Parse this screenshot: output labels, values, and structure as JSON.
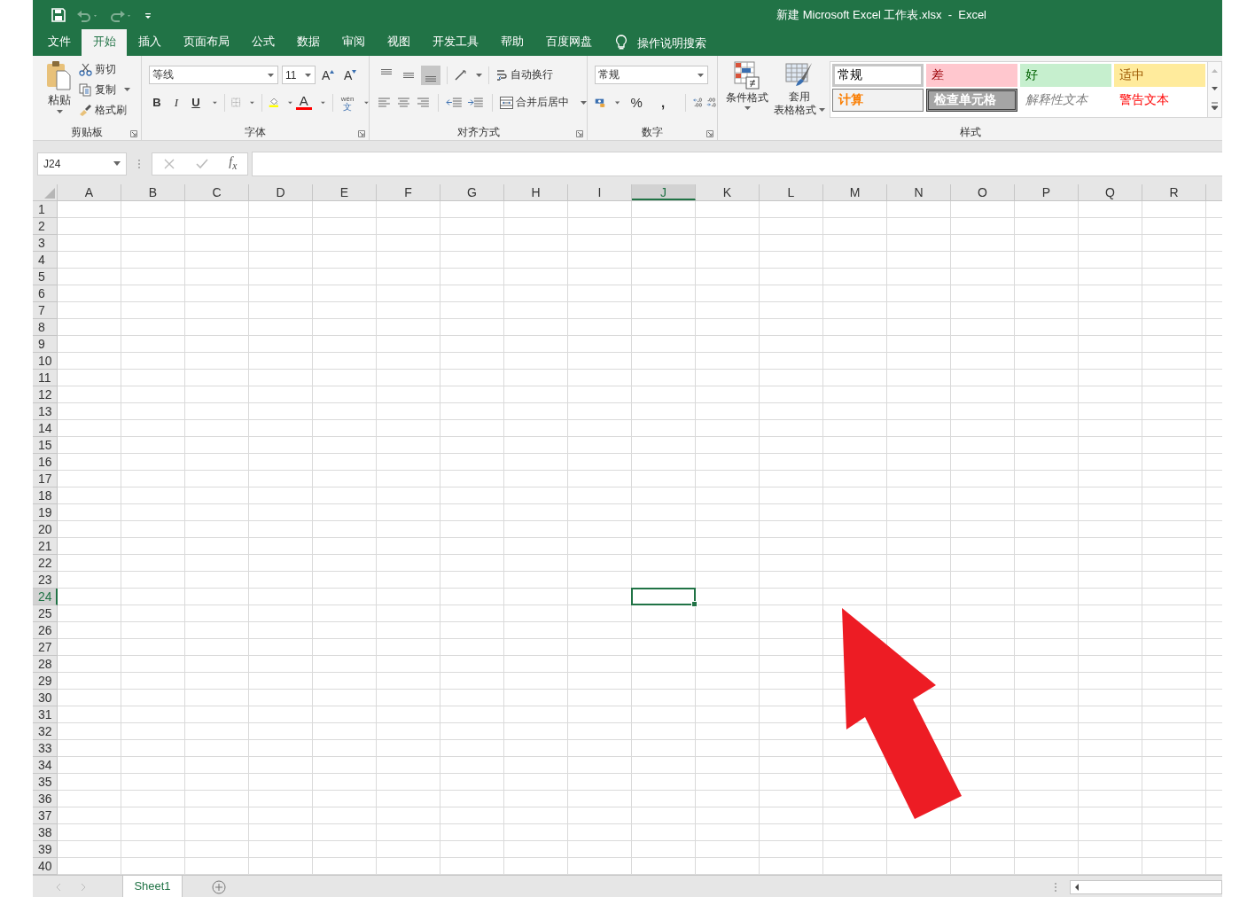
{
  "title_bar": {
    "title": "新建 Microsoft Excel 工作表.xlsx  -  Excel"
  },
  "ribbon_tabs": [
    {
      "label": "文件",
      "selected": false
    },
    {
      "label": "开始",
      "selected": true
    },
    {
      "label": "插入",
      "selected": false
    },
    {
      "label": "页面布局",
      "selected": false
    },
    {
      "label": "公式",
      "selected": false
    },
    {
      "label": "数据",
      "selected": false
    },
    {
      "label": "审阅",
      "selected": false
    },
    {
      "label": "视图",
      "selected": false
    },
    {
      "label": "开发工具",
      "selected": false
    },
    {
      "label": "帮助",
      "selected": false
    },
    {
      "label": "百度网盘",
      "selected": false
    }
  ],
  "tell_me": {
    "label": "操作说明搜索"
  },
  "clipboard": {
    "paste": "粘贴",
    "cut": "剪切",
    "copy": "复制",
    "format_painter": "格式刷",
    "label": "剪贴板"
  },
  "font": {
    "font_name": "等线",
    "font_size": "11",
    "grow": "A",
    "shrink": "A",
    "bold": "B",
    "italic": "I",
    "underline": "U",
    "font_color": "A",
    "phonetic_top": "wén",
    "phonetic_bottom": "文",
    "label": "字体"
  },
  "alignment": {
    "vertical": [
      {
        "kind": "top",
        "selected": false
      },
      {
        "kind": "middle",
        "selected": false
      },
      {
        "kind": "bottom",
        "selected": true
      }
    ],
    "wrap_text": "自动换行",
    "merge_center": "合并后居中",
    "label": "对齐方式"
  },
  "number": {
    "format": "常规",
    "percent": "%",
    "comma": ",",
    "label": "数字"
  },
  "styles": {
    "conditional_formatting": "条件格式",
    "format_as_table": [
      "套用",
      "表格格式"
    ],
    "gallery": [
      {
        "label": "常规",
        "kind": "normal",
        "selected": true
      },
      {
        "label": "差",
        "kind": "bad",
        "selected": false
      },
      {
        "label": "好",
        "kind": "good",
        "selected": false
      },
      {
        "label": "适中",
        "kind": "neutral",
        "selected": false
      },
      {
        "label": "计算",
        "kind": "calculation",
        "selected": false
      },
      {
        "label": "检查单元格",
        "kind": "check",
        "selected": false
      },
      {
        "label": "解释性文本",
        "kind": "explanatory",
        "selected": false
      },
      {
        "label": "警告文本",
        "kind": "warning",
        "selected": false
      }
    ],
    "label": "样式"
  },
  "formula_bar": {
    "name_box": "J24",
    "function": "f$_{x}$"
  },
  "sheet": {
    "columns": [
      {
        "label": "A",
        "selected": false
      },
      {
        "label": "B",
        "selected": false
      },
      {
        "label": "C",
        "selected": false
      },
      {
        "label": "D",
        "selected": false
      },
      {
        "label": "E",
        "selected": false
      },
      {
        "label": "F",
        "selected": false
      },
      {
        "label": "G",
        "selected": false
      },
      {
        "label": "H",
        "selected": false
      },
      {
        "label": "I",
        "selected": false
      },
      {
        "label": "J",
        "selected": true
      },
      {
        "label": "K",
        "selected": false
      },
      {
        "label": "L",
        "selected": false
      },
      {
        "label": "M",
        "selected": false
      },
      {
        "label": "N",
        "selected": false
      },
      {
        "label": "O",
        "selected": false
      },
      {
        "label": "P",
        "selected": false
      },
      {
        "label": "Q",
        "selected": false
      },
      {
        "label": "R",
        "selected": false
      }
    ],
    "rows": [
      {
        "label": "1",
        "selected": false
      },
      {
        "label": "2",
        "selected": false
      },
      {
        "label": "3",
        "selected": false
      },
      {
        "label": "4",
        "selected": false
      },
      {
        "label": "5",
        "selected": false
      },
      {
        "label": "6",
        "selected": false
      },
      {
        "label": "7",
        "selected": false
      },
      {
        "label": "8",
        "selected": false
      },
      {
        "label": "9",
        "selected": false
      },
      {
        "label": "10",
        "selected": false
      },
      {
        "label": "11",
        "selected": false
      },
      {
        "label": "12",
        "selected": false
      },
      {
        "label": "13",
        "selected": false
      },
      {
        "label": "14",
        "selected": false
      },
      {
        "label": "15",
        "selected": false
      },
      {
        "label": "16",
        "selected": false
      },
      {
        "label": "17",
        "selected": false
      },
      {
        "label": "18",
        "selected": false
      },
      {
        "label": "19",
        "selected": false
      },
      {
        "label": "20",
        "selected": false
      },
      {
        "label": "21",
        "selected": false
      },
      {
        "label": "22",
        "selected": false
      },
      {
        "label": "23",
        "selected": false
      },
      {
        "label": "24",
        "selected": true
      },
      {
        "label": "25",
        "selected": false
      },
      {
        "label": "26",
        "selected": false
      },
      {
        "label": "27",
        "selected": false
      },
      {
        "label": "28",
        "selected": false
      },
      {
        "label": "29",
        "selected": false
      },
      {
        "label": "30",
        "selected": false
      },
      {
        "label": "31",
        "selected": false
      },
      {
        "label": "32",
        "selected": false
      },
      {
        "label": "33",
        "selected": false
      },
      {
        "label": "34",
        "selected": false
      },
      {
        "label": "35",
        "selected": false
      },
      {
        "label": "36",
        "selected": false
      },
      {
        "label": "37",
        "selected": false
      },
      {
        "label": "38",
        "selected": false
      },
      {
        "label": "39",
        "selected": false
      },
      {
        "label": "40",
        "selected": false
      }
    ]
  },
  "sheet_tabs": [
    {
      "label": "Sheet1",
      "selected": true
    }
  ],
  "annotations": [
    {
      "kind": "arrow"
    }
  ]
}
